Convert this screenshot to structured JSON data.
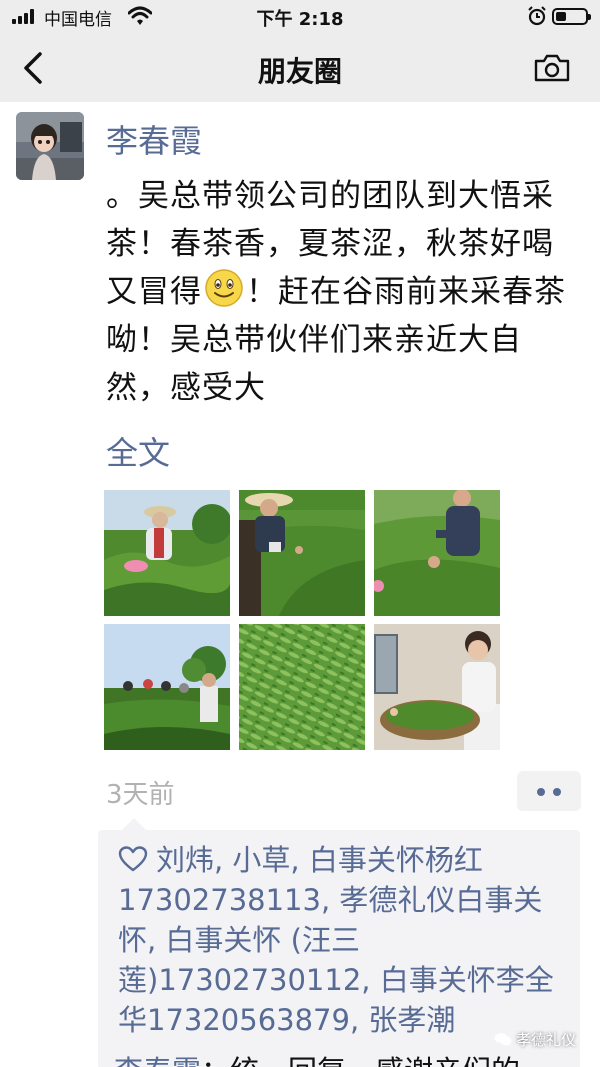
{
  "status_bar": {
    "carrier": "中国电信",
    "time": "下午 2:18",
    "battery_level": 0.35
  },
  "nav": {
    "title": "朋友圈"
  },
  "post": {
    "author": "李春霞",
    "text_part1": "。吴总带领公司的团队到大悟采茶！春茶香，夏茶涩，秋茶好喝又冒得",
    "emoji": "smile-emoji",
    "text_part2": "！赶在谷雨前来采春茶呦！吴总带伙伴们来亲近大自然，感受大",
    "full_text_link": "全文",
    "time": "3天前",
    "photos": [
      "woman-in-hat-picking-tea",
      "woman-in-sunhat-in-tea-rows",
      "woman-picking-tea-in-field",
      "group-picking-tea-under-sky",
      "fresh-green-tea-leaves",
      "woman-holding-tea-basket"
    ]
  },
  "likes": {
    "text": "刘炜, 小草, 白事关怀杨红17302738113, 孝德礼仪白事关怀, 白事关怀 (汪三莲)17302730112, 白事关怀李全华17320563879, 张孝潮"
  },
  "comment_peek": {
    "name": "李春霞",
    "text": "：统一回复，感谢亲们的"
  },
  "watermark": {
    "text": "孝德礼仪"
  },
  "colors": {
    "link": "#576b95",
    "background": "#ffffff",
    "bar": "#ededed",
    "likes_box": "#f3f3f5",
    "muted": "#b2b2b2"
  }
}
